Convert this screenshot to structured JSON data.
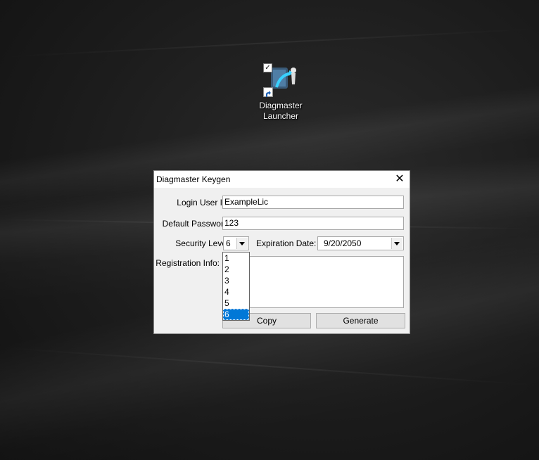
{
  "desktop": {
    "icon": {
      "name": "diagmaster-launcher-icon",
      "label_line1": "Diagmaster",
      "label_line2": "Launcher"
    }
  },
  "dialog": {
    "title": "Diagmaster Keygen",
    "close_glyph": "✕",
    "login_label": "Login User ID:",
    "login_value": "ExampleLic",
    "password_label": "Default Password:",
    "password_value": "123",
    "security_label": "Security Level:",
    "security_value": "6",
    "security_options": [
      "1",
      "2",
      "3",
      "4",
      "5",
      "6"
    ],
    "security_selected": "6",
    "expiration_label": "Expiration Date:",
    "expiration_value": "9/20/2050",
    "registration_label": "Registration Info:",
    "registration_value": "",
    "copy_label": "Copy",
    "generate_label": "Generate"
  },
  "colors": {
    "selection": "#0078d7",
    "dialog_bg": "#f0f0f0"
  }
}
